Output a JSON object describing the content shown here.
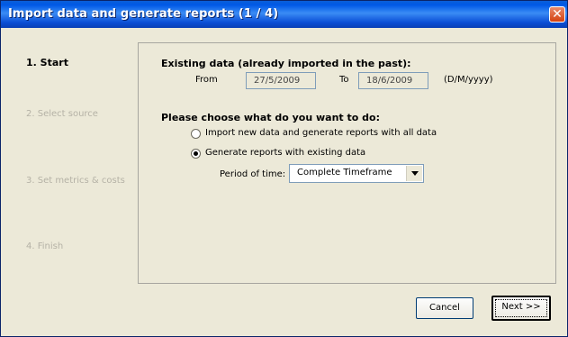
{
  "window": {
    "title": "Import data and generate reports (1 / 4)",
    "close_icon": "close-icon"
  },
  "steps": [
    {
      "label": "1. Start",
      "active": true
    },
    {
      "label": "2. Select source",
      "active": false
    },
    {
      "label": "3. Set metrics & costs",
      "active": false
    },
    {
      "label": "4. Finish",
      "active": false
    }
  ],
  "existing": {
    "heading": "Existing data (already imported in the past):",
    "from_label": "From",
    "from_value": "27/5/2009",
    "to_label": "To",
    "to_value": "18/6/2009",
    "format_hint": "(D/M/yyyy)"
  },
  "choice": {
    "heading": "Please choose what do you want to do:",
    "option_import": "Import new data and generate reports with all data",
    "option_generate": "Generate reports with existing data",
    "selected": "generate",
    "period_label": "Period of time:",
    "period_value": "Complete Timeframe"
  },
  "buttons": {
    "cancel": "Cancel",
    "next": "Next >>"
  },
  "colors": {
    "titlebar": "#0058e6",
    "face": "#ece9d8",
    "disabled_text": "#b5b2a6"
  }
}
